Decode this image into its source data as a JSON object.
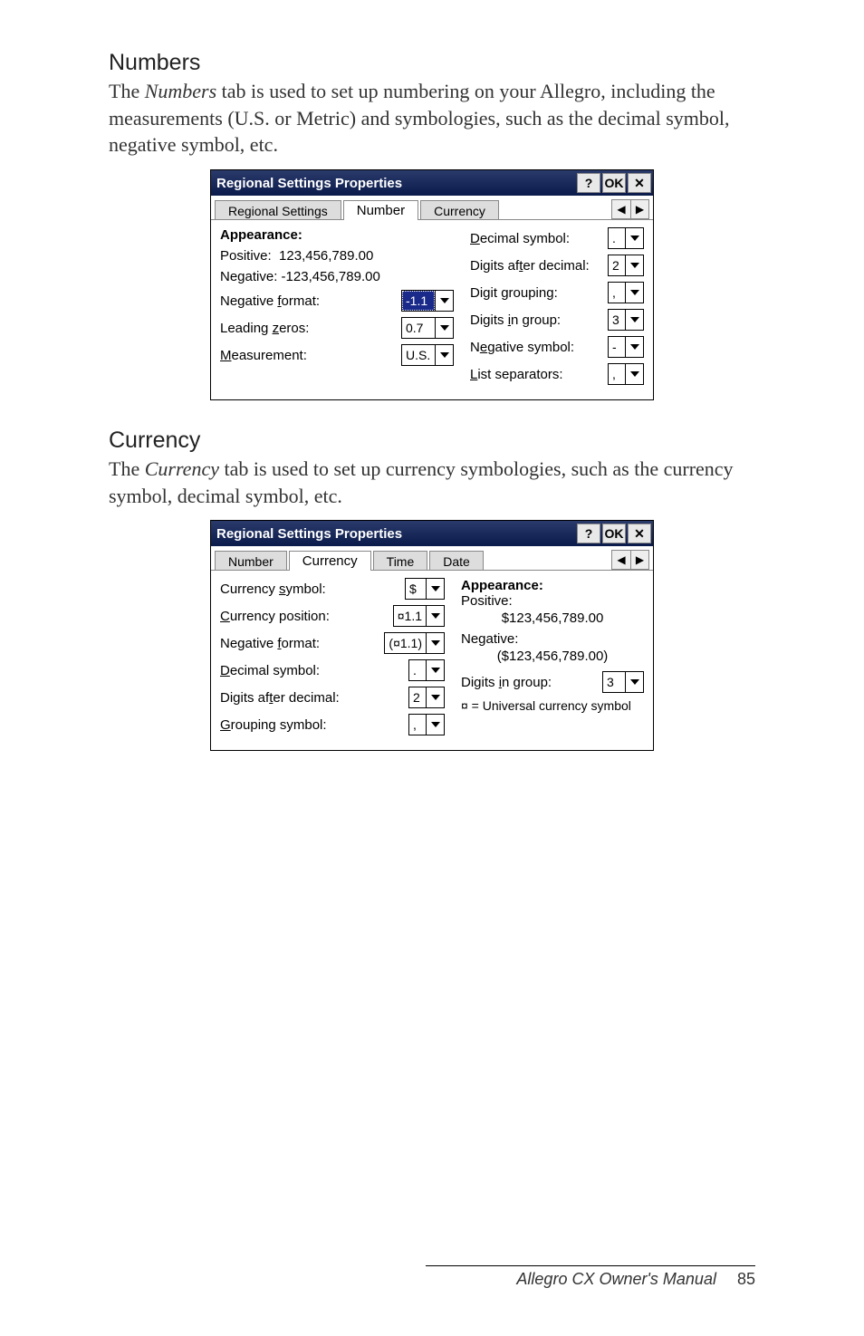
{
  "sections": {
    "numbers": {
      "heading": "Numbers",
      "body_pre": "The ",
      "body_em": "Numbers",
      "body_post": " tab is used to set up numbering on your Allegro, including the measurements (U.S. or Metric) and symbologies, such as the decimal symbol, negative symbol, etc."
    },
    "currency": {
      "heading": "Currency",
      "body_pre": "The ",
      "body_em": "Currency",
      "body_post": " tab is used to set up currency symbologies, such as the currency symbol, decimal symbol, etc."
    }
  },
  "dialog1": {
    "title": "Regional Settings Properties",
    "help": "?",
    "ok": "OK",
    "close": "✕",
    "tabs": {
      "t1": "Regional Settings",
      "t2": "Number",
      "t3": "Currency"
    },
    "spin": {
      "left": "◀",
      "right": "▶"
    },
    "labels": {
      "appearance": "Appearance:",
      "positive_pre": "Positive:",
      "positive_val": "123,456,789.00",
      "negative_pre": "Negative:",
      "negative_val": "-123,456,789.00",
      "neg_format": "Negative format:",
      "neg_format_u": "f",
      "leading_zeros": "Leading zeros:",
      "leading_zeros_u": "z",
      "measurement": "Measurement:",
      "measurement_u": "M",
      "dec_symbol": "Decimal symbol:",
      "dec_symbol_u": "D",
      "digits_after": "Digits after decimal:",
      "digits_after_u": "t",
      "digit_grouping": "Digit grouping:",
      "digit_grouping_u": "g",
      "digits_in_group": "Digits in group:",
      "digits_in_group_u": "i",
      "neg_symbol": "Negative symbol:",
      "neg_symbol_u": "e",
      "list_sep": "List separators:",
      "list_sep_u": "L"
    },
    "values": {
      "neg_format": "-1.1",
      "leading": "0.7",
      "measurement": "U.S.",
      "dec_symbol": ".",
      "digits_after": "2",
      "digit_grouping": ",",
      "digits_in_group": "3",
      "neg_symbol": "-",
      "list_sep": ","
    }
  },
  "dialog2": {
    "title": "Regional Settings Properties",
    "help": "?",
    "ok": "OK",
    "close": "✕",
    "tabs": {
      "t1": "Number",
      "t2": "Currency",
      "t3": "Time",
      "t4": "Date"
    },
    "spin": {
      "left": "◀",
      "right": "▶"
    },
    "labels": {
      "currency_symbol": "Currency symbol:",
      "currency_symbol_u": "s",
      "currency_position": "Currency position:",
      "currency_position_u": "C",
      "neg_format": "Negative format:",
      "neg_format_u": "f",
      "decimal_symbol": "Decimal symbol:",
      "decimal_symbol_u": "D",
      "digits_after": "Digits after decimal:",
      "digits_after_u": "t",
      "grouping_symbol": "Grouping symbol:",
      "grouping_symbol_u": "G",
      "appearance": "Appearance:",
      "positive": "Positive:",
      "negative": "Negative:",
      "digits_in_group": "Digits in group:",
      "digits_in_group_u": "i",
      "footnote": "¤ = Universal currency symbol"
    },
    "values": {
      "currency_symbol": "$",
      "currency_position": "¤1.1",
      "neg_format": "(¤1.1)",
      "decimal_symbol": ".",
      "digits_after": "2",
      "grouping_symbol": ",",
      "positive_val": "$123,456,789.00",
      "negative_val": "($123,456,789.00)",
      "digits_in_group": "3"
    }
  },
  "footer": {
    "text": "Allegro CX Owner's Manual",
    "page": "85"
  }
}
